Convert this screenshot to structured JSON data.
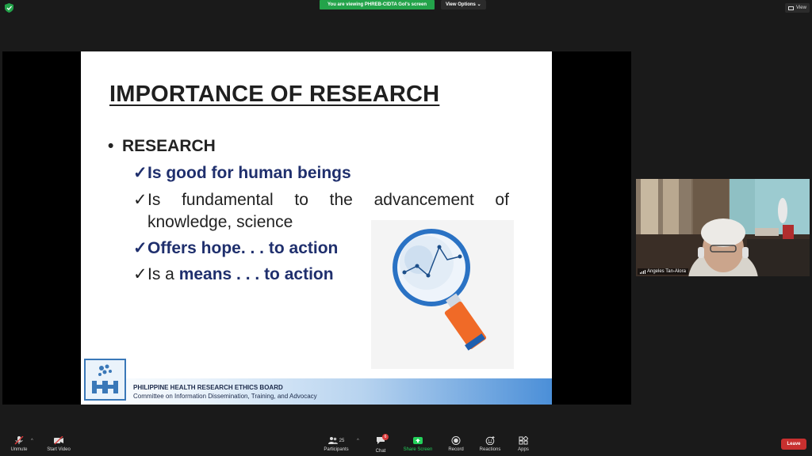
{
  "topbar": {
    "banner_text": "You are viewing PHREB-CIDTA GoI's screen",
    "view_options_label": "View Options",
    "view_label": "View"
  },
  "slide": {
    "title": "IMPORTANCE OF RESEARCH",
    "bullet": "RESEARCH",
    "check": "✓",
    "items": {
      "i1": "Is good for human beings",
      "i2_words": [
        "Is",
        "fundamental",
        "to",
        "the",
        "advancement",
        "of"
      ],
      "i2_line2": "knowledge, science",
      "i3": "Offers hope. . . to action",
      "i4_prefix": "Is a ",
      "i4_bold": "means . . . to action"
    },
    "footer_org": "PHILIPPINE HEALTH RESEARCH ETHICS BOARD",
    "footer_committee": "Committee on Information Dissemination, Training, and Advocacy"
  },
  "participant": {
    "name": "Angeles Tan-Alora"
  },
  "toolbar": {
    "unmute": "Unmute",
    "start_video": "Start Video",
    "participants": "Participants",
    "participant_count": "25",
    "chat": "Chat",
    "chat_badge": "6",
    "share_screen": "Share Screen",
    "record": "Record",
    "reactions": "Reactions",
    "apps": "Apps",
    "leave": "Leave"
  },
  "colors": {
    "banner_green": "#23a34a",
    "share_green": "#23d15a",
    "leave_red": "#c8302f",
    "slide_blue": "#1f2f6d"
  }
}
